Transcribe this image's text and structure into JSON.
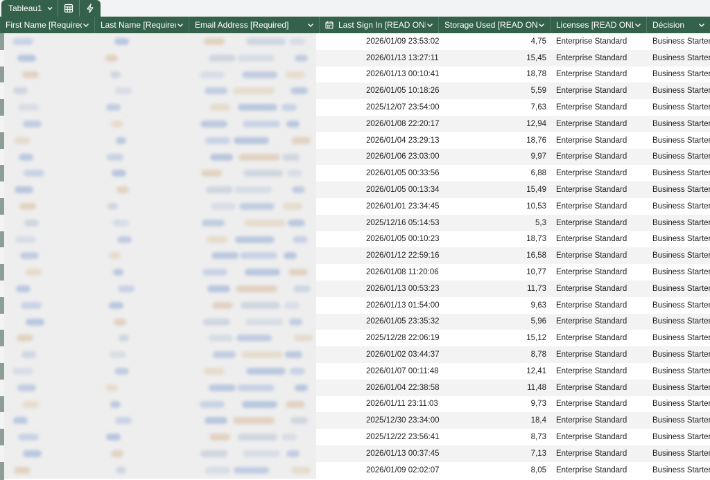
{
  "tabbar": {
    "sheet_name": "Tableau1"
  },
  "columns": [
    "First Name [Required]",
    "Last Name [Required]",
    "Email Address [Required]",
    "Last Sign In [READ ONLY]",
    "Storage Used [READ ONLY]",
    "Licenses [READ ONLY]",
    "Décision"
  ],
  "rows": [
    {
      "last_sign_in": "2026/01/09 23:53:02",
      "storage": "4,75",
      "license": "Enterprise Standard",
      "decision": "Business Starter"
    },
    {
      "last_sign_in": "2026/01/13 13:27:11",
      "storage": "15,45",
      "license": "Enterprise Standard",
      "decision": "Business Starter"
    },
    {
      "last_sign_in": "2026/01/13 00:10:41",
      "storage": "18,78",
      "license": "Enterprise Standard",
      "decision": "Business Starter"
    },
    {
      "last_sign_in": "2026/01/05 10:18:26",
      "storage": "5,59",
      "license": "Enterprise Standard",
      "decision": "Business Starter"
    },
    {
      "last_sign_in": "2025/12/07 23:54:00",
      "storage": "7,63",
      "license": "Enterprise Standard",
      "decision": "Business Starter"
    },
    {
      "last_sign_in": "2026/01/08 22:20:17",
      "storage": "12,94",
      "license": "Enterprise Standard",
      "decision": "Business Starter"
    },
    {
      "last_sign_in": "2026/01/04 23:29:13",
      "storage": "18,76",
      "license": "Enterprise Standard",
      "decision": "Business Starter"
    },
    {
      "last_sign_in": "2026/01/06 23:03:00",
      "storage": "9,97",
      "license": "Enterprise Standard",
      "decision": "Business Starter"
    },
    {
      "last_sign_in": "2026/01/05 00:33:56",
      "storage": "6,88",
      "license": "Enterprise Standard",
      "decision": "Business Starter"
    },
    {
      "last_sign_in": "2026/01/05 00:13:34",
      "storage": "15,49",
      "license": "Enterprise Standard",
      "decision": "Business Starter"
    },
    {
      "last_sign_in": "2026/01/01 23:34:45",
      "storage": "10,53",
      "license": "Enterprise Standard",
      "decision": "Business Starter"
    },
    {
      "last_sign_in": "2025/12/16 05:14:53",
      "storage": "5,3",
      "license": "Enterprise Standard",
      "decision": "Business Starter"
    },
    {
      "last_sign_in": "2026/01/05 00:10:23",
      "storage": "18,73",
      "license": "Enterprise Standard",
      "decision": "Business Starter"
    },
    {
      "last_sign_in": "2026/01/12 22:59:16",
      "storage": "16,58",
      "license": "Enterprise Standard",
      "decision": "Business Starter"
    },
    {
      "last_sign_in": "2026/01/08 11:20:06",
      "storage": "10,77",
      "license": "Enterprise Standard",
      "decision": "Business Starter"
    },
    {
      "last_sign_in": "2026/01/13 00:53:23",
      "storage": "11,73",
      "license": "Enterprise Standard",
      "decision": "Business Starter"
    },
    {
      "last_sign_in": "2026/01/13 01:54:00",
      "storage": "9,63",
      "license": "Enterprise Standard",
      "decision": "Business Starter"
    },
    {
      "last_sign_in": "2026/01/05 23:35:32",
      "storage": "5,96",
      "license": "Enterprise Standard",
      "decision": "Business Starter"
    },
    {
      "last_sign_in": "2025/12/28 22:06:19",
      "storage": "15,12",
      "license": "Enterprise Standard",
      "decision": "Business Starter"
    },
    {
      "last_sign_in": "2026/01/02 03:44:37",
      "storage": "8,78",
      "license": "Enterprise Standard",
      "decision": "Business Starter"
    },
    {
      "last_sign_in": "2026/01/07 00:11:48",
      "storage": "12,41",
      "license": "Enterprise Standard",
      "decision": "Business Starter"
    },
    {
      "last_sign_in": "2026/01/04 22:38:58",
      "storage": "11,48",
      "license": "Enterprise Standard",
      "decision": "Business Starter"
    },
    {
      "last_sign_in": "2026/01/11 23:11:03",
      "storage": "9,73",
      "license": "Enterprise Standard",
      "decision": "Business Starter"
    },
    {
      "last_sign_in": "2025/12/30 23:34:00",
      "storage": "18,4",
      "license": "Enterprise Standard",
      "decision": "Business Starter"
    },
    {
      "last_sign_in": "2025/12/22 23:56:41",
      "storage": "8,73",
      "license": "Enterprise Standard",
      "decision": "Business Starter"
    },
    {
      "last_sign_in": "2026/01/13 00:37:45",
      "storage": "7,13",
      "license": "Enterprise Standard",
      "decision": "Business Starter"
    },
    {
      "last_sign_in": "2026/01/09 02:02:07",
      "storage": "8,05",
      "license": "Enterprise Standard",
      "decision": "Business Starter"
    }
  ],
  "colors": {
    "header_bg": "#34614a",
    "header_text": "#ffffff",
    "alt_row": "#f3f3f3",
    "redacted": "#eeeeee"
  },
  "icons": [
    "chevron-down-icon",
    "table-view-icon",
    "lightning-icon",
    "calendar-icon"
  ]
}
